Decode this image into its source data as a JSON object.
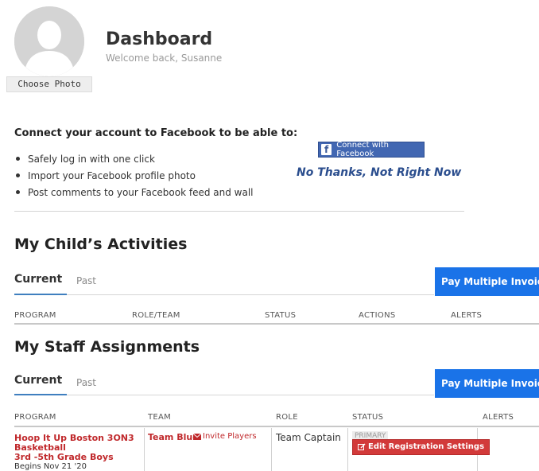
{
  "header": {
    "title": "Dashboard",
    "welcome": "Welcome back, Susanne",
    "choose_photo": "Choose Photo"
  },
  "facebook": {
    "heading": "Connect your account to Facebook to be able to:",
    "benefits": [
      "Safely log in with one click",
      "Import your Facebook profile photo",
      "Post comments to your Facebook feed and wall"
    ],
    "connect_label": "Connect with Facebook",
    "connect_icon_glyph": "f",
    "no_thanks": "No Thanks, Not Right Now",
    "brand_color": "#4267b2"
  },
  "activities": {
    "title": "My Child’s Activities",
    "tabs": [
      "Current",
      "Past"
    ],
    "pay_label": "Pay Multiple Invoices",
    "columns": [
      "PROGRAM",
      "ROLE/TEAM",
      "STATUS",
      "ACTIONS",
      "ALERTS"
    ]
  },
  "staff": {
    "title": "My Staff Assignments",
    "tabs": [
      "Current",
      "Past"
    ],
    "pay_label": "Pay Multiple Invoices",
    "columns": [
      "PROGRAM",
      "TEAM",
      "ROLE",
      "STATUS",
      "ALERTS"
    ],
    "rows": [
      {
        "program_line1": "Hoop It Up Boston 3ON3",
        "program_line2": "Basketball",
        "program_line3": "3rd -5th Grade Boys",
        "begins": "Begins Nov 21 '20",
        "team": "Team Blue",
        "invite": "Invite Players",
        "role": "Team Captain",
        "status_badge": "PRIMARY",
        "action": "Edit Registration Settings"
      }
    ]
  },
  "colors": {
    "accent_blue": "#1a73e8",
    "link_red": "#c0282b",
    "action_red": "#d23a3a"
  }
}
